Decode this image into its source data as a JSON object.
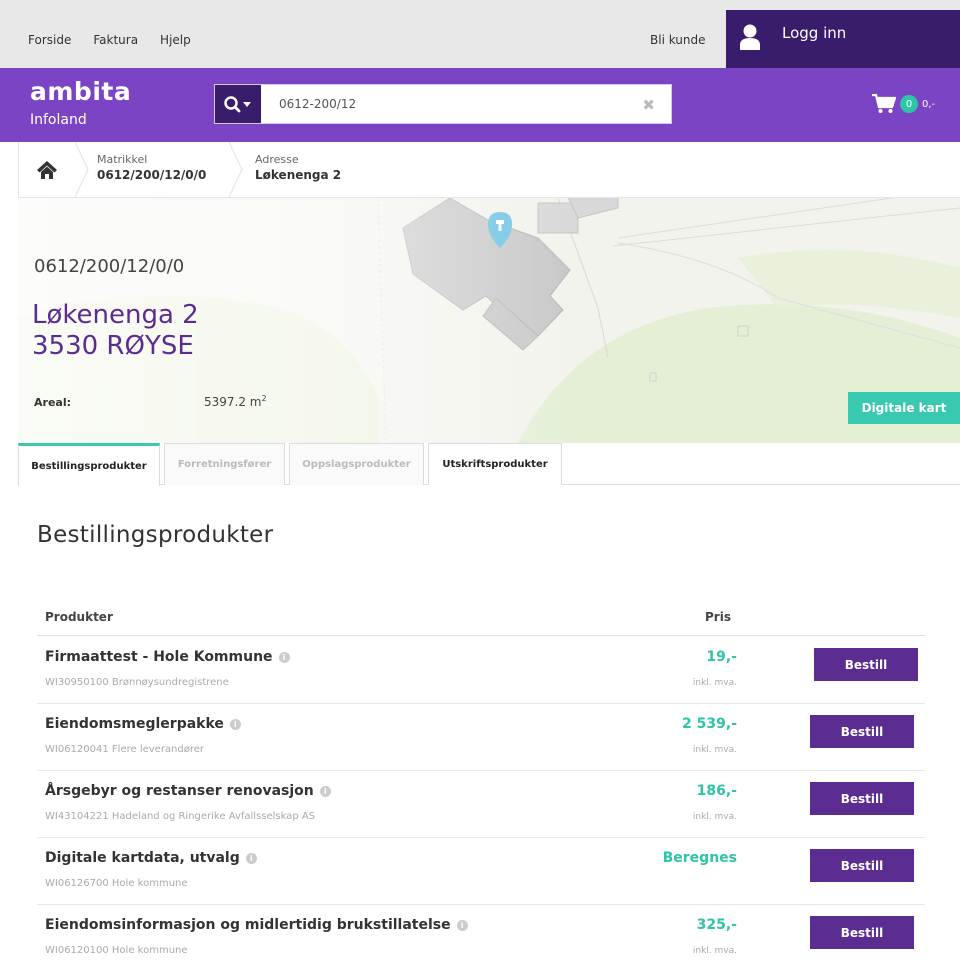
{
  "topnav": {
    "links": [
      "Forside",
      "Faktura",
      "Hjelp"
    ],
    "bli_kunde": "Bli kunde",
    "login_label": "Logg inn"
  },
  "header": {
    "brand": "ambita",
    "sub": "Infoland",
    "search_value": "0612-200/12",
    "cart_count": "0",
    "cart_amount": "0,-"
  },
  "breadcrumb": {
    "items": [
      {
        "key": "Matrikkel",
        "value": "0612/200/12/0/0"
      },
      {
        "key": "Adresse",
        "value": "Løkenenga 2"
      }
    ]
  },
  "property": {
    "matrikkel": "0612/200/12/0/0",
    "address_line1": "Løkenenga 2",
    "address_line2": "3530 RØYSE",
    "areal_label": "Areal:",
    "areal_value": "5397.2 m",
    "areal_unit_sup": "2",
    "digitale_kart_label": "Digitale kart"
  },
  "tabs": [
    {
      "label": "Bestillingsprodukter",
      "state": "active"
    },
    {
      "label": "Forretningsfører",
      "state": "disabled"
    },
    {
      "label": "Oppslagsprodukter",
      "state": "disabled"
    },
    {
      "label": "Utskriftsprodukter",
      "state": "normal"
    }
  ],
  "section": {
    "title": "Bestillingsprodukter",
    "col_product": "Produkter",
    "col_price": "Pris"
  },
  "products": [
    {
      "name": "Firmaattest - Hole Kommune",
      "code": "WI30950100 Brønnøysundregistrene",
      "price": "19,-",
      "mva": "inkl. mva.",
      "button": "Bestill"
    },
    {
      "name": "Eiendomsmeglerpakke",
      "code": "WI06120041 Flere leverandører",
      "price": "2 539,-",
      "mva": "inkl. mva.",
      "button": "Bestill"
    },
    {
      "name": "Årsgebyr og restanser renovasjon",
      "code": "WI43104221 Hadeland og Ringerike Avfallsselskap AS",
      "price": "186,-",
      "mva": "inkl. mva.",
      "button": "Bestill"
    },
    {
      "name": "Digitale kartdata, utvalg",
      "code": "WI06126700 Hole kommune",
      "price": "Beregnes",
      "mva": "",
      "button": "Bestill"
    },
    {
      "name": "Eiendomsinformasjon og midlertidig brukstillatelse",
      "code": "WI06120100 Hole kommune",
      "price": "325,-",
      "mva": "inkl. mva.",
      "button": "Bestill"
    }
  ],
  "colors": {
    "purple_header": "#7b44c4",
    "dark_purple": "#3a1c6c",
    "button_purple": "#5b2d91",
    "teal": "#2ec4a6"
  },
  "icons": {
    "user": "user-icon",
    "search": "search-icon",
    "clear": "clear-icon",
    "cart": "cart-icon",
    "home": "home-icon",
    "map_pin": "map-pin-icon",
    "info": "info-icon"
  }
}
